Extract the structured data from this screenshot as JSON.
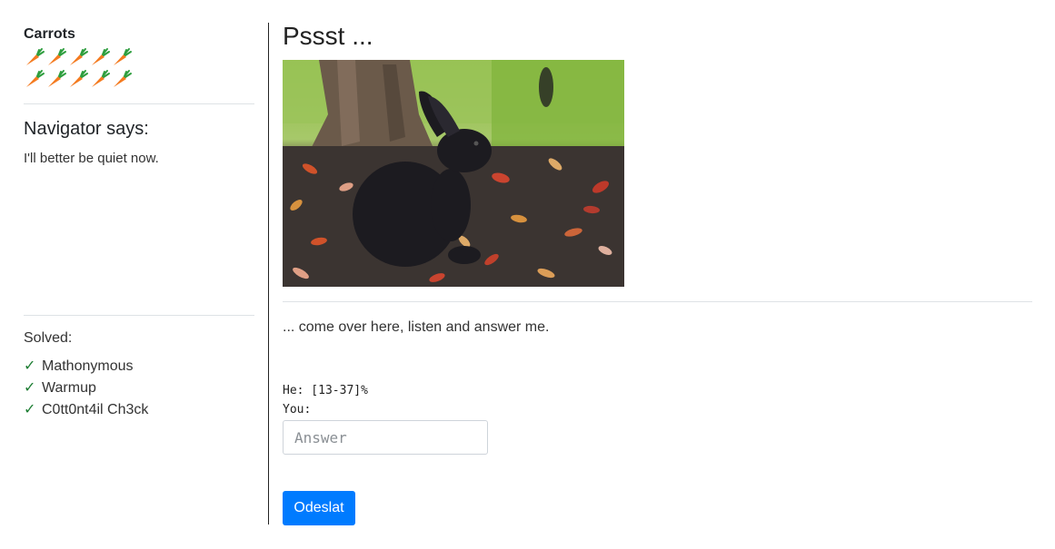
{
  "sidebar": {
    "carrots_title": "Carrots",
    "carrot_count": 10,
    "navigator_title": "Navigator says:",
    "navigator_text": "I'll better be quiet now.",
    "solved_title": "Solved:",
    "solved": [
      {
        "label": "Mathonymous"
      },
      {
        "label": "Warmup"
      },
      {
        "label": "C0tt0nt4il Ch3ck"
      }
    ]
  },
  "main": {
    "title": "Pssst ...",
    "prompt": "... come over here, listen and answer me.",
    "he_line": "He: [13-37]%",
    "you_label": "You:",
    "answer_placeholder": "Answer",
    "submit_label": "Odeslat"
  },
  "colors": {
    "accent": "#007bff",
    "check": "#1e7e34",
    "carrot": "#f47b20",
    "carrot_leaf": "#2e9e3e"
  }
}
